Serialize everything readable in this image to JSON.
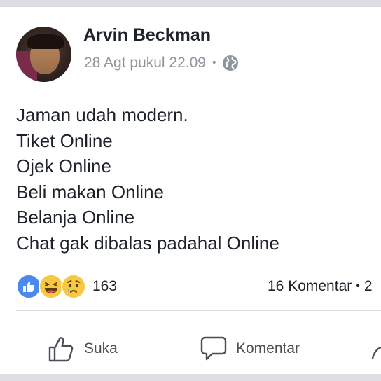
{
  "post": {
    "author_name": "Arvin Beckman",
    "timestamp": "28 Agt pukul 22.09",
    "separator": "•",
    "privacy_icon": "globe-icon",
    "text_lines": [
      "Jaman udah modern.",
      "Tiket Online",
      "Ojek Online",
      "Beli makan Online",
      "Belanja Online",
      "Chat gak dibalas padahal Online"
    ]
  },
  "engagement": {
    "reaction_icons": [
      "like-reaction-icon",
      "haha-reaction-icon",
      "sad-reaction-icon"
    ],
    "reaction_count": "163",
    "comments_label": "16 Komentar",
    "separator": "•",
    "shares_truncated": "2"
  },
  "actions": {
    "like_label": "Suka",
    "comment_label": "Komentar"
  },
  "colors": {
    "background": "#dcdee3",
    "card": "#ffffff",
    "text": "#1d2129",
    "meta": "#90949c",
    "action_text": "#4b4f56",
    "like_blue": "#4b88f0",
    "emoji_yellow": "#f7c942"
  }
}
